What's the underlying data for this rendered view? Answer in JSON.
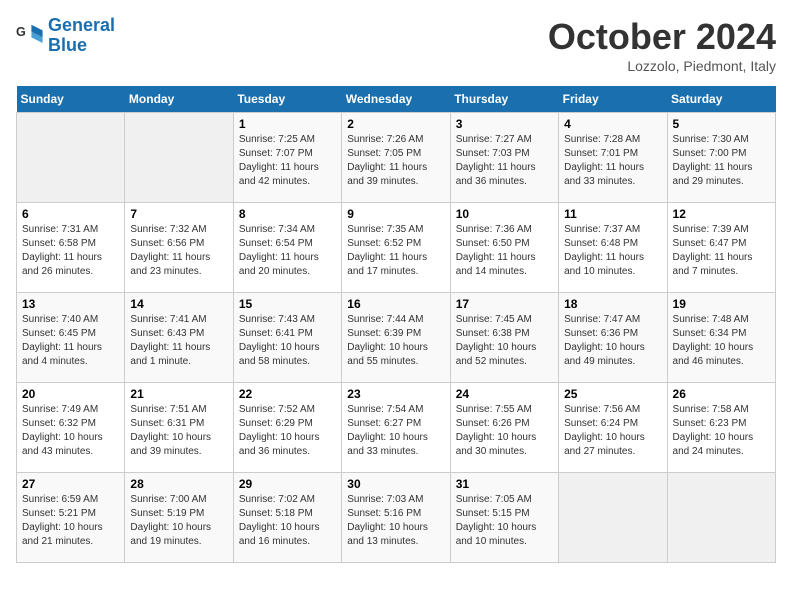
{
  "header": {
    "logo_line1": "General",
    "logo_line2": "Blue",
    "month_title": "October 2024",
    "location": "Lozzolo, Piedmont, Italy"
  },
  "weekdays": [
    "Sunday",
    "Monday",
    "Tuesday",
    "Wednesday",
    "Thursday",
    "Friday",
    "Saturday"
  ],
  "weeks": [
    [
      {
        "day": "",
        "info": ""
      },
      {
        "day": "",
        "info": ""
      },
      {
        "day": "1",
        "info": "Sunrise: 7:25 AM\nSunset: 7:07 PM\nDaylight: 11 hours and 42 minutes."
      },
      {
        "day": "2",
        "info": "Sunrise: 7:26 AM\nSunset: 7:05 PM\nDaylight: 11 hours and 39 minutes."
      },
      {
        "day": "3",
        "info": "Sunrise: 7:27 AM\nSunset: 7:03 PM\nDaylight: 11 hours and 36 minutes."
      },
      {
        "day": "4",
        "info": "Sunrise: 7:28 AM\nSunset: 7:01 PM\nDaylight: 11 hours and 33 minutes."
      },
      {
        "day": "5",
        "info": "Sunrise: 7:30 AM\nSunset: 7:00 PM\nDaylight: 11 hours and 29 minutes."
      }
    ],
    [
      {
        "day": "6",
        "info": "Sunrise: 7:31 AM\nSunset: 6:58 PM\nDaylight: 11 hours and 26 minutes."
      },
      {
        "day": "7",
        "info": "Sunrise: 7:32 AM\nSunset: 6:56 PM\nDaylight: 11 hours and 23 minutes."
      },
      {
        "day": "8",
        "info": "Sunrise: 7:34 AM\nSunset: 6:54 PM\nDaylight: 11 hours and 20 minutes."
      },
      {
        "day": "9",
        "info": "Sunrise: 7:35 AM\nSunset: 6:52 PM\nDaylight: 11 hours and 17 minutes."
      },
      {
        "day": "10",
        "info": "Sunrise: 7:36 AM\nSunset: 6:50 PM\nDaylight: 11 hours and 14 minutes."
      },
      {
        "day": "11",
        "info": "Sunrise: 7:37 AM\nSunset: 6:48 PM\nDaylight: 11 hours and 10 minutes."
      },
      {
        "day": "12",
        "info": "Sunrise: 7:39 AM\nSunset: 6:47 PM\nDaylight: 11 hours and 7 minutes."
      }
    ],
    [
      {
        "day": "13",
        "info": "Sunrise: 7:40 AM\nSunset: 6:45 PM\nDaylight: 11 hours and 4 minutes."
      },
      {
        "day": "14",
        "info": "Sunrise: 7:41 AM\nSunset: 6:43 PM\nDaylight: 11 hours and 1 minute."
      },
      {
        "day": "15",
        "info": "Sunrise: 7:43 AM\nSunset: 6:41 PM\nDaylight: 10 hours and 58 minutes."
      },
      {
        "day": "16",
        "info": "Sunrise: 7:44 AM\nSunset: 6:39 PM\nDaylight: 10 hours and 55 minutes."
      },
      {
        "day": "17",
        "info": "Sunrise: 7:45 AM\nSunset: 6:38 PM\nDaylight: 10 hours and 52 minutes."
      },
      {
        "day": "18",
        "info": "Sunrise: 7:47 AM\nSunset: 6:36 PM\nDaylight: 10 hours and 49 minutes."
      },
      {
        "day": "19",
        "info": "Sunrise: 7:48 AM\nSunset: 6:34 PM\nDaylight: 10 hours and 46 minutes."
      }
    ],
    [
      {
        "day": "20",
        "info": "Sunrise: 7:49 AM\nSunset: 6:32 PM\nDaylight: 10 hours and 43 minutes."
      },
      {
        "day": "21",
        "info": "Sunrise: 7:51 AM\nSunset: 6:31 PM\nDaylight: 10 hours and 39 minutes."
      },
      {
        "day": "22",
        "info": "Sunrise: 7:52 AM\nSunset: 6:29 PM\nDaylight: 10 hours and 36 minutes."
      },
      {
        "day": "23",
        "info": "Sunrise: 7:54 AM\nSunset: 6:27 PM\nDaylight: 10 hours and 33 minutes."
      },
      {
        "day": "24",
        "info": "Sunrise: 7:55 AM\nSunset: 6:26 PM\nDaylight: 10 hours and 30 minutes."
      },
      {
        "day": "25",
        "info": "Sunrise: 7:56 AM\nSunset: 6:24 PM\nDaylight: 10 hours and 27 minutes."
      },
      {
        "day": "26",
        "info": "Sunrise: 7:58 AM\nSunset: 6:23 PM\nDaylight: 10 hours and 24 minutes."
      }
    ],
    [
      {
        "day": "27",
        "info": "Sunrise: 6:59 AM\nSunset: 5:21 PM\nDaylight: 10 hours and 21 minutes."
      },
      {
        "day": "28",
        "info": "Sunrise: 7:00 AM\nSunset: 5:19 PM\nDaylight: 10 hours and 19 minutes."
      },
      {
        "day": "29",
        "info": "Sunrise: 7:02 AM\nSunset: 5:18 PM\nDaylight: 10 hours and 16 minutes."
      },
      {
        "day": "30",
        "info": "Sunrise: 7:03 AM\nSunset: 5:16 PM\nDaylight: 10 hours and 13 minutes."
      },
      {
        "day": "31",
        "info": "Sunrise: 7:05 AM\nSunset: 5:15 PM\nDaylight: 10 hours and 10 minutes."
      },
      {
        "day": "",
        "info": ""
      },
      {
        "day": "",
        "info": ""
      }
    ]
  ]
}
